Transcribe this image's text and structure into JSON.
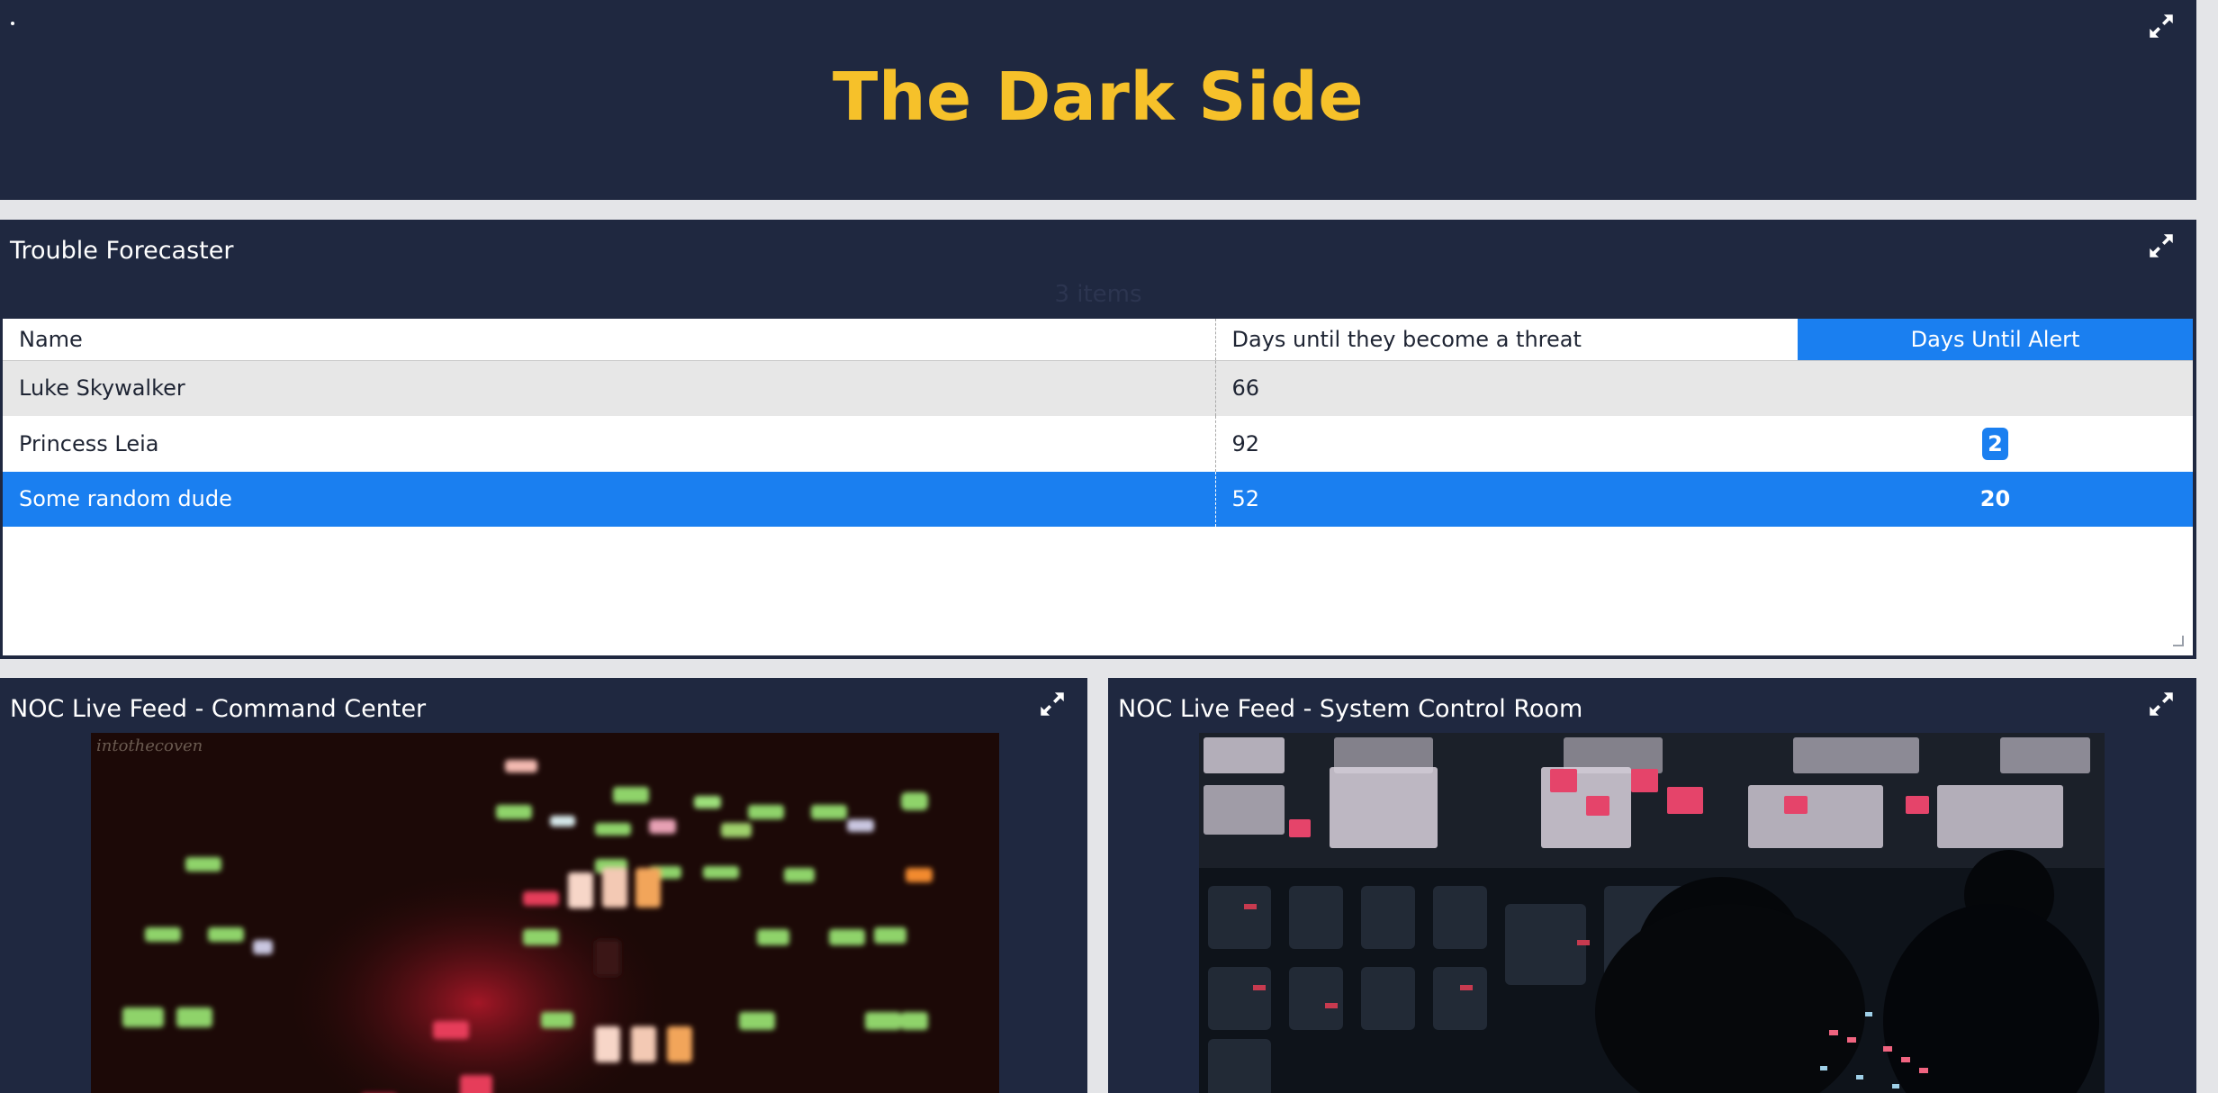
{
  "header": {
    "title": "The Dark Side"
  },
  "forecaster": {
    "title": "Trouble Forecaster",
    "items_count": "3 items",
    "columns": [
      "Name",
      "Days until they become a threat",
      "Days Until Alert"
    ],
    "rows": [
      {
        "name": "Luke Skywalker",
        "days": "66",
        "alert": ""
      },
      {
        "name": "Princess Leia",
        "days": "92",
        "alert": "2"
      },
      {
        "name": "Some random dude",
        "days": "52",
        "alert": "20"
      }
    ]
  },
  "feeds": {
    "command_center": {
      "title": "NOC Live Feed - Command Center",
      "watermark": "intothecoven"
    },
    "system_control": {
      "title": "NOC Live Feed - System Control Room"
    }
  },
  "colors": {
    "panel_bg": "#1f2840",
    "title_accent": "#f6c12a",
    "highlight_blue": "#1a7ff0",
    "page_bg": "#e4e5e8"
  },
  "icons": {
    "expand": "expand-arrows-icon"
  }
}
